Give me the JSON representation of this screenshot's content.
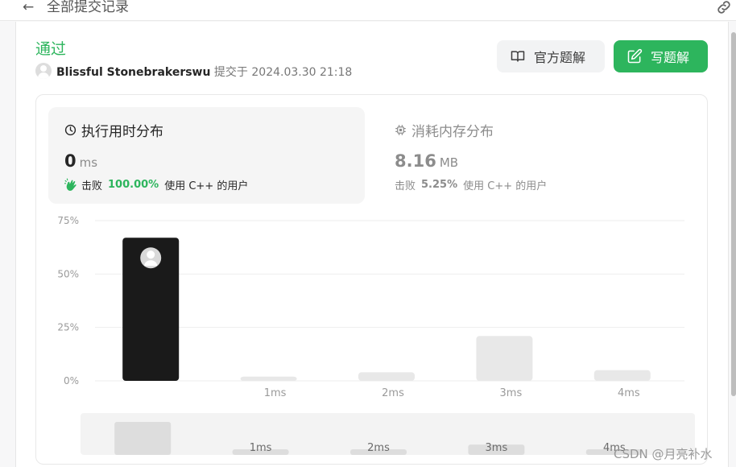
{
  "topbar": {
    "back_icon": "arrow-left-icon",
    "title": "全部提交记录",
    "link_icon": "link-icon"
  },
  "submission": {
    "status": "通过",
    "user": "Blissful Stonebrakerswu",
    "submitted_label": "提交于",
    "submitted_at": "2024.03.30 21:18"
  },
  "actions": {
    "official_label": "官方题解",
    "write_label": "写题解",
    "accent": "#2db55d"
  },
  "runtime": {
    "title": "执行用时分布",
    "value": "0",
    "unit": "ms",
    "beats_label": "击败",
    "beats_pct": "100.00%",
    "beats_suffix": "使用 C++ 的用户"
  },
  "memory": {
    "title": "消耗内存分布",
    "value": "8.16",
    "unit": "MB",
    "beats_label": "击败",
    "beats_pct": "5.25%",
    "beats_suffix": "使用 C++ 的用户"
  },
  "chart_data": {
    "type": "bar",
    "categories": [
      "",
      "1ms",
      "2ms",
      "3ms",
      "4ms"
    ],
    "values": [
      67,
      2,
      4,
      21,
      5
    ],
    "highlight_index": 0,
    "yticks": [
      "75%",
      "50%",
      "25%",
      "0%"
    ],
    "ylim": [
      0,
      75
    ],
    "colors": {
      "highlight": "#1a1a1a",
      "bar": "#e8e8e8",
      "grid": "#eeeeee"
    },
    "overview": {
      "categories": [
        "",
        "1ms",
        "2ms",
        "3ms",
        "4ms"
      ],
      "values": [
        67,
        2,
        4,
        21,
        5
      ]
    }
  },
  "watermark": "CSDN @月亮补水"
}
